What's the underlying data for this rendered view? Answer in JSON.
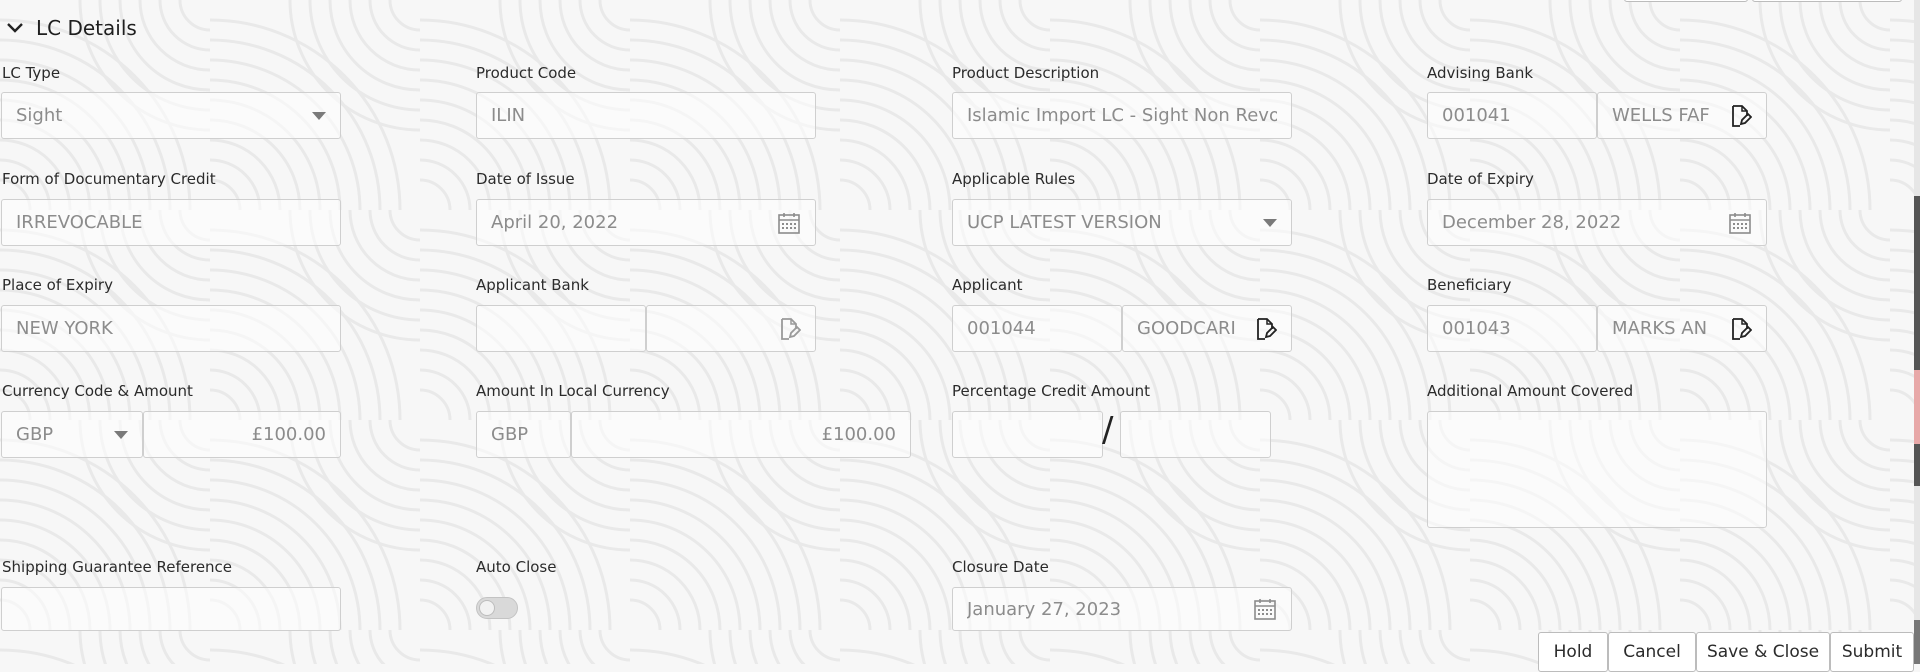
{
  "section": {
    "title": "LC Details"
  },
  "fields": {
    "lc_type": {
      "label": "LC Type",
      "value": "Sight"
    },
    "product_code": {
      "label": "Product Code",
      "value": "ILIN"
    },
    "product_description": {
      "label": "Product Description",
      "value": "Islamic Import LC - Sight Non Revolv"
    },
    "advising_bank": {
      "label": "Advising Bank",
      "code": "001041",
      "name": "WELLS FAF"
    },
    "form_of_credit": {
      "label": "Form of Documentary Credit",
      "value": "IRREVOCABLE"
    },
    "date_of_issue": {
      "label": "Date of Issue",
      "value": "April 20, 2022"
    },
    "applicable_rules": {
      "label": "Applicable Rules",
      "value": "UCP LATEST VERSION"
    },
    "date_of_expiry": {
      "label": "Date of Expiry",
      "value": "December 28, 2022"
    },
    "place_of_expiry": {
      "label": "Place of Expiry",
      "value": "NEW YORK"
    },
    "applicant_bank": {
      "label": "Applicant Bank",
      "code": "",
      "name": ""
    },
    "applicant": {
      "label": "Applicant",
      "code": "001044",
      "name": "GOODCARI"
    },
    "beneficiary": {
      "label": "Beneficiary",
      "code": "001043",
      "name": "MARKS AN"
    },
    "currency_amount": {
      "label": "Currency Code & Amount",
      "currency": "GBP",
      "amount": "£100.00"
    },
    "local_currency": {
      "label": "Amount In Local Currency",
      "currency": "GBP",
      "amount": "£100.00"
    },
    "percentage_credit": {
      "label": "Percentage Credit Amount",
      "left": "",
      "separator": "/",
      "right": ""
    },
    "additional_amount": {
      "label": "Additional Amount Covered",
      "value": ""
    },
    "shipping_guarantee": {
      "label": "Shipping Guarantee Reference",
      "value": ""
    },
    "auto_close": {
      "label": "Auto Close",
      "state": "off"
    },
    "closure_date": {
      "label": "Closure Date",
      "value": "January 27, 2023"
    }
  },
  "buttons": {
    "hold": "Hold",
    "cancel": "Cancel",
    "save_close": "Save & Close",
    "submit": "Submit"
  },
  "icons": {
    "section_toggle": "chevron-down-icon",
    "dropdown": "caret-down-icon",
    "calendar": "calendar-icon",
    "lookup": "document-edit-icon"
  }
}
